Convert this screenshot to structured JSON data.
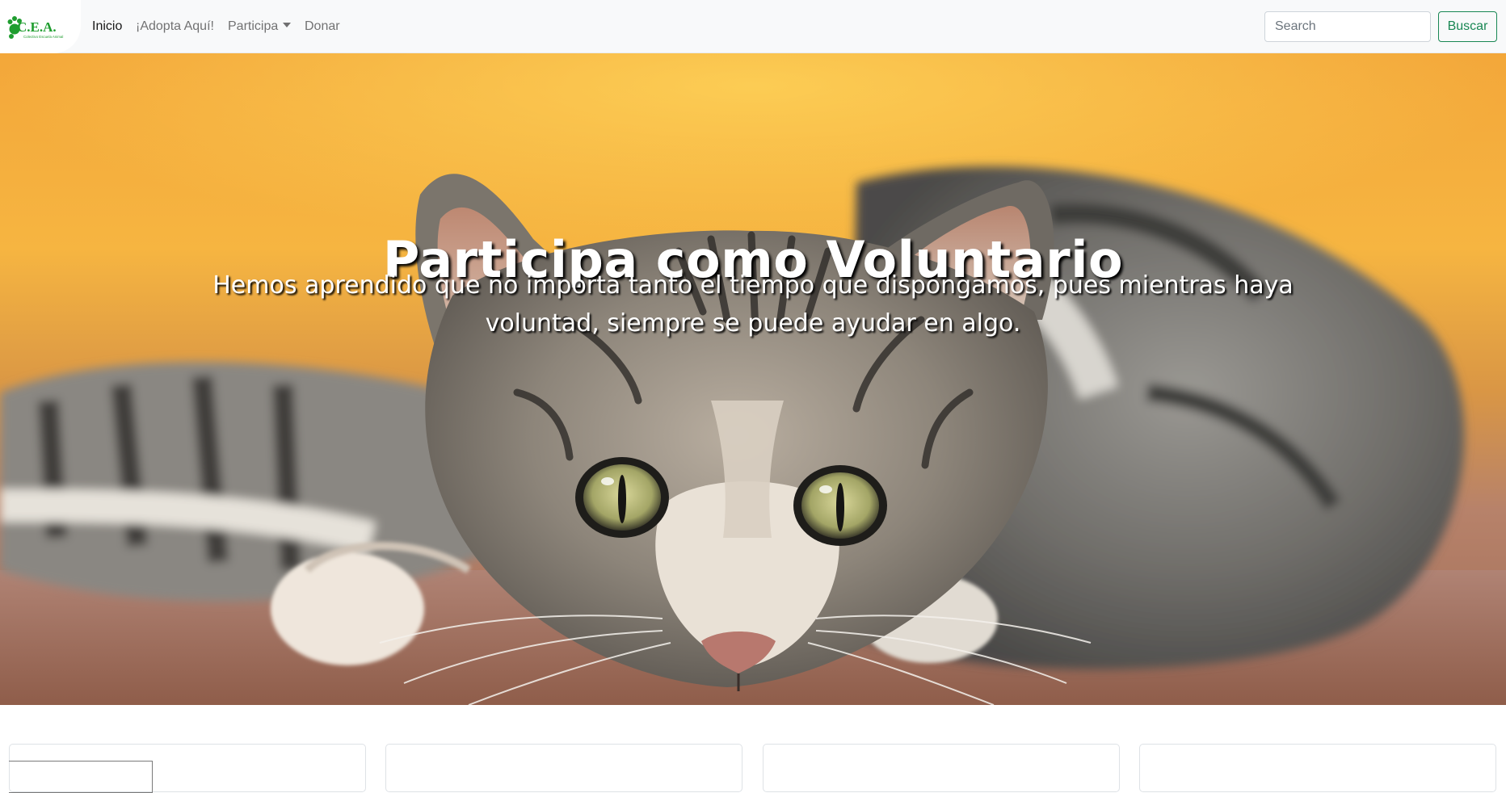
{
  "navbar": {
    "logo_text": "C.E.A.",
    "logo_subtext": "Colectivo Escuela Animal",
    "links": [
      {
        "label": "Inicio",
        "active": true
      },
      {
        "label": "¡Adopta Aquí!",
        "active": false
      },
      {
        "label": "Participa",
        "active": false,
        "dropdown": true
      },
      {
        "label": "Donar",
        "active": false
      }
    ],
    "search": {
      "placeholder": "Search",
      "value": ""
    },
    "search_button": "Buscar"
  },
  "hero": {
    "title": "Participa como Voluntario",
    "subtitle": "Hemos aprendido que no importa tanto el tiempo que dispongamos, pues mientras haya voluntad, siempre se puede ayudar en algo.",
    "background": "tabby cat lying on the ground in front of a yellow-orange background"
  },
  "colors": {
    "navbar_bg": "#f8f9fa",
    "accent_green": "#198754",
    "logo_green": "#1f9d2f",
    "hero_orange": "#f1aa3a"
  }
}
